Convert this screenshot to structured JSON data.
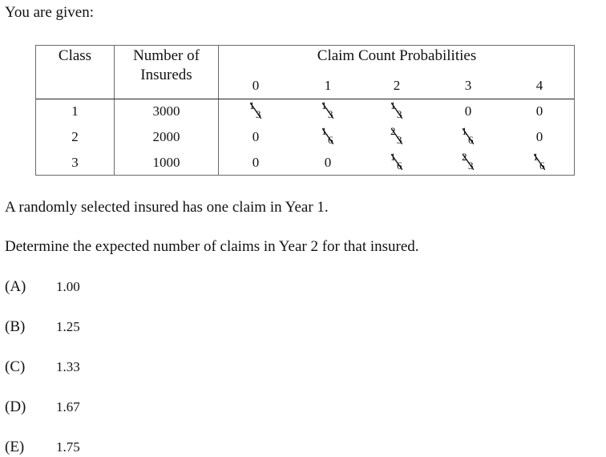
{
  "intro": "You are given:",
  "table": {
    "headers": {
      "class": "Class",
      "insureds_line1": "Number of",
      "insureds_line2": "Insureds",
      "probabilities": "Claim Count Probabilities",
      "counts": [
        "0",
        "1",
        "2",
        "3",
        "4"
      ]
    },
    "rows": [
      {
        "class": "1",
        "insureds": "3000",
        "probs": [
          {
            "num": "1",
            "den": "3"
          },
          {
            "num": "1",
            "den": "3"
          },
          {
            "num": "1",
            "den": "3"
          },
          {
            "value": "0"
          },
          {
            "value": "0"
          }
        ]
      },
      {
        "class": "2",
        "insureds": "2000",
        "probs": [
          {
            "value": "0"
          },
          {
            "num": "1",
            "den": "6"
          },
          {
            "num": "2",
            "den": "3"
          },
          {
            "num": "1",
            "den": "6"
          },
          {
            "value": "0"
          }
        ]
      },
      {
        "class": "3",
        "insureds": "1000",
        "probs": [
          {
            "value": "0"
          },
          {
            "value": "0"
          },
          {
            "num": "1",
            "den": "6"
          },
          {
            "num": "2",
            "den": "3"
          },
          {
            "num": "1",
            "den": "6"
          }
        ]
      }
    ]
  },
  "statement": "A randomly selected insured has one claim in Year 1.",
  "question": "Determine the expected number of claims in Year 2 for that insured.",
  "choices": [
    {
      "label": "(A)",
      "value": "1.00"
    },
    {
      "label": "(B)",
      "value": "1.25"
    },
    {
      "label": "(C)",
      "value": "1.33"
    },
    {
      "label": "(D)",
      "value": "1.67"
    },
    {
      "label": "(E)",
      "value": "1.75"
    }
  ]
}
